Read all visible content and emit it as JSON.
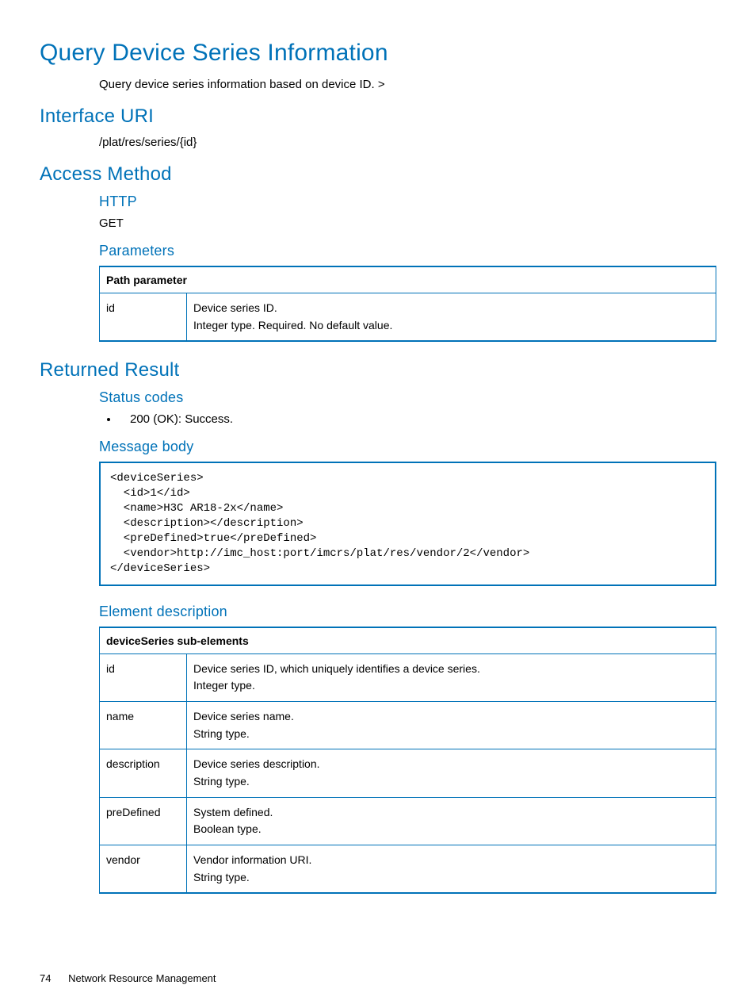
{
  "title": "Query Device Series Information",
  "intro": "Query device series information based on device ID. >",
  "uri": {
    "heading": "Interface URI",
    "value": "/plat/res/series/{id}"
  },
  "access": {
    "heading": "Access Method",
    "httpLabel": "HTTP",
    "httpMethod": "GET",
    "parametersLabel": "Parameters",
    "paramTable": {
      "header": "Path parameter",
      "rows": [
        {
          "name": "id",
          "desc": "Device series ID.\nInteger type. Required. No default value."
        }
      ]
    }
  },
  "result": {
    "heading": "Returned Result",
    "statusLabel": "Status codes",
    "statusItems": [
      "200 (OK): Success."
    ],
    "messageLabel": "Message body",
    "messageBody": "<deviceSeries>\n  <id>1</id>\n  <name>H3C AR18-2x</name>\n  <description></description>\n  <preDefined>true</preDefined>\n  <vendor>http://imc_host:port/imcrs/plat/res/vendor/2</vendor>\n</deviceSeries>",
    "elementLabel": "Element description",
    "elementTable": {
      "header": "deviceSeries sub-elements",
      "rows": [
        {
          "name": "id",
          "desc": "Device series ID, which uniquely identifies a device series.\nInteger type."
        },
        {
          "name": "name",
          "desc": "Device series name.\nString type."
        },
        {
          "name": "description",
          "desc": "Device series description.\nString type."
        },
        {
          "name": "preDefined",
          "desc": "System defined.\nBoolean type."
        },
        {
          "name": "vendor",
          "desc": "Vendor information URI.\nString type."
        }
      ]
    }
  },
  "footer": {
    "page": "74",
    "section": "Network Resource Management"
  }
}
